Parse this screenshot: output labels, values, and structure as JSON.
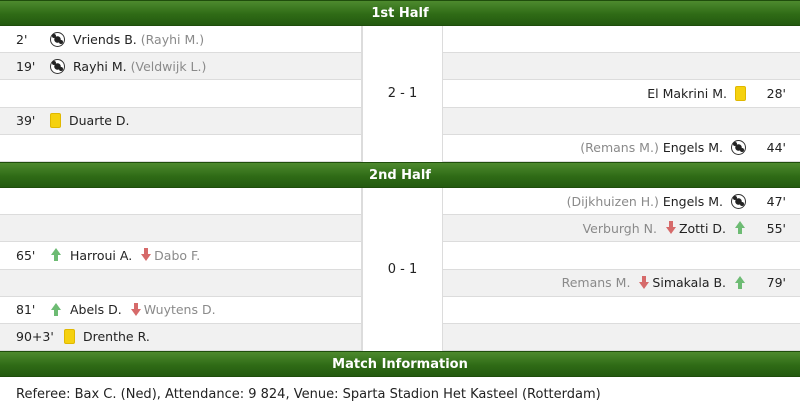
{
  "first_half": {
    "title": "1st Half",
    "score": "2 - 1",
    "events": [
      {
        "side": "left",
        "minute": "2'",
        "icon": "ball-icon",
        "player": "Vriends B.",
        "assist": "(Rayhi M.)"
      },
      {
        "side": "left",
        "minute": "19'",
        "icon": "ball-icon",
        "player": "Rayhi M.",
        "assist": "(Veldwijk L.)"
      },
      {
        "side": "right",
        "minute": "28'",
        "icon": "yellow-card-icon",
        "player": "El Makrini M.",
        "assist": ""
      },
      {
        "side": "left",
        "minute": "39'",
        "icon": "yellow-card-icon",
        "player": "Duarte D.",
        "assist": ""
      },
      {
        "side": "right",
        "minute": "44'",
        "icon": "ball-icon",
        "player": "Engels M.",
        "assist": "(Remans M.)"
      }
    ]
  },
  "second_half": {
    "title": "2nd Half",
    "score": "0 - 1",
    "events": [
      {
        "side": "right",
        "minute": "47'",
        "icon": "ball-icon",
        "player": "Engels M.",
        "assist": "(Dijkhuizen H.)"
      },
      {
        "side": "right",
        "minute": "55'",
        "icon": "substitution",
        "player_in": "Zotti D.",
        "player_out": "Verburgh N."
      },
      {
        "side": "left",
        "minute": "65'",
        "icon": "substitution",
        "player_in": "Harroui A.",
        "player_out": "Dabo F."
      },
      {
        "side": "right",
        "minute": "79'",
        "icon": "substitution",
        "player_in": "Simakala B.",
        "player_out": "Remans M."
      },
      {
        "side": "left",
        "minute": "81'",
        "icon": "substitution",
        "player_in": "Abels D.",
        "player_out": "Wuytens D."
      },
      {
        "side": "left",
        "minute": "90+3'",
        "icon": "yellow-card-icon",
        "player": "Drenthe R.",
        "assist": ""
      }
    ]
  },
  "match_info": {
    "title": "Match Information",
    "text": "Referee: Bax C. (Ned), Attendance: 9 824, Venue: Sparta Stadion Het Kasteel (Rotterdam)"
  },
  "colors": {
    "header_green": "#2f6b16",
    "yellow_card": "#f5d10f",
    "sub_in": "#6dbb73",
    "sub_out": "#d66a6a"
  }
}
